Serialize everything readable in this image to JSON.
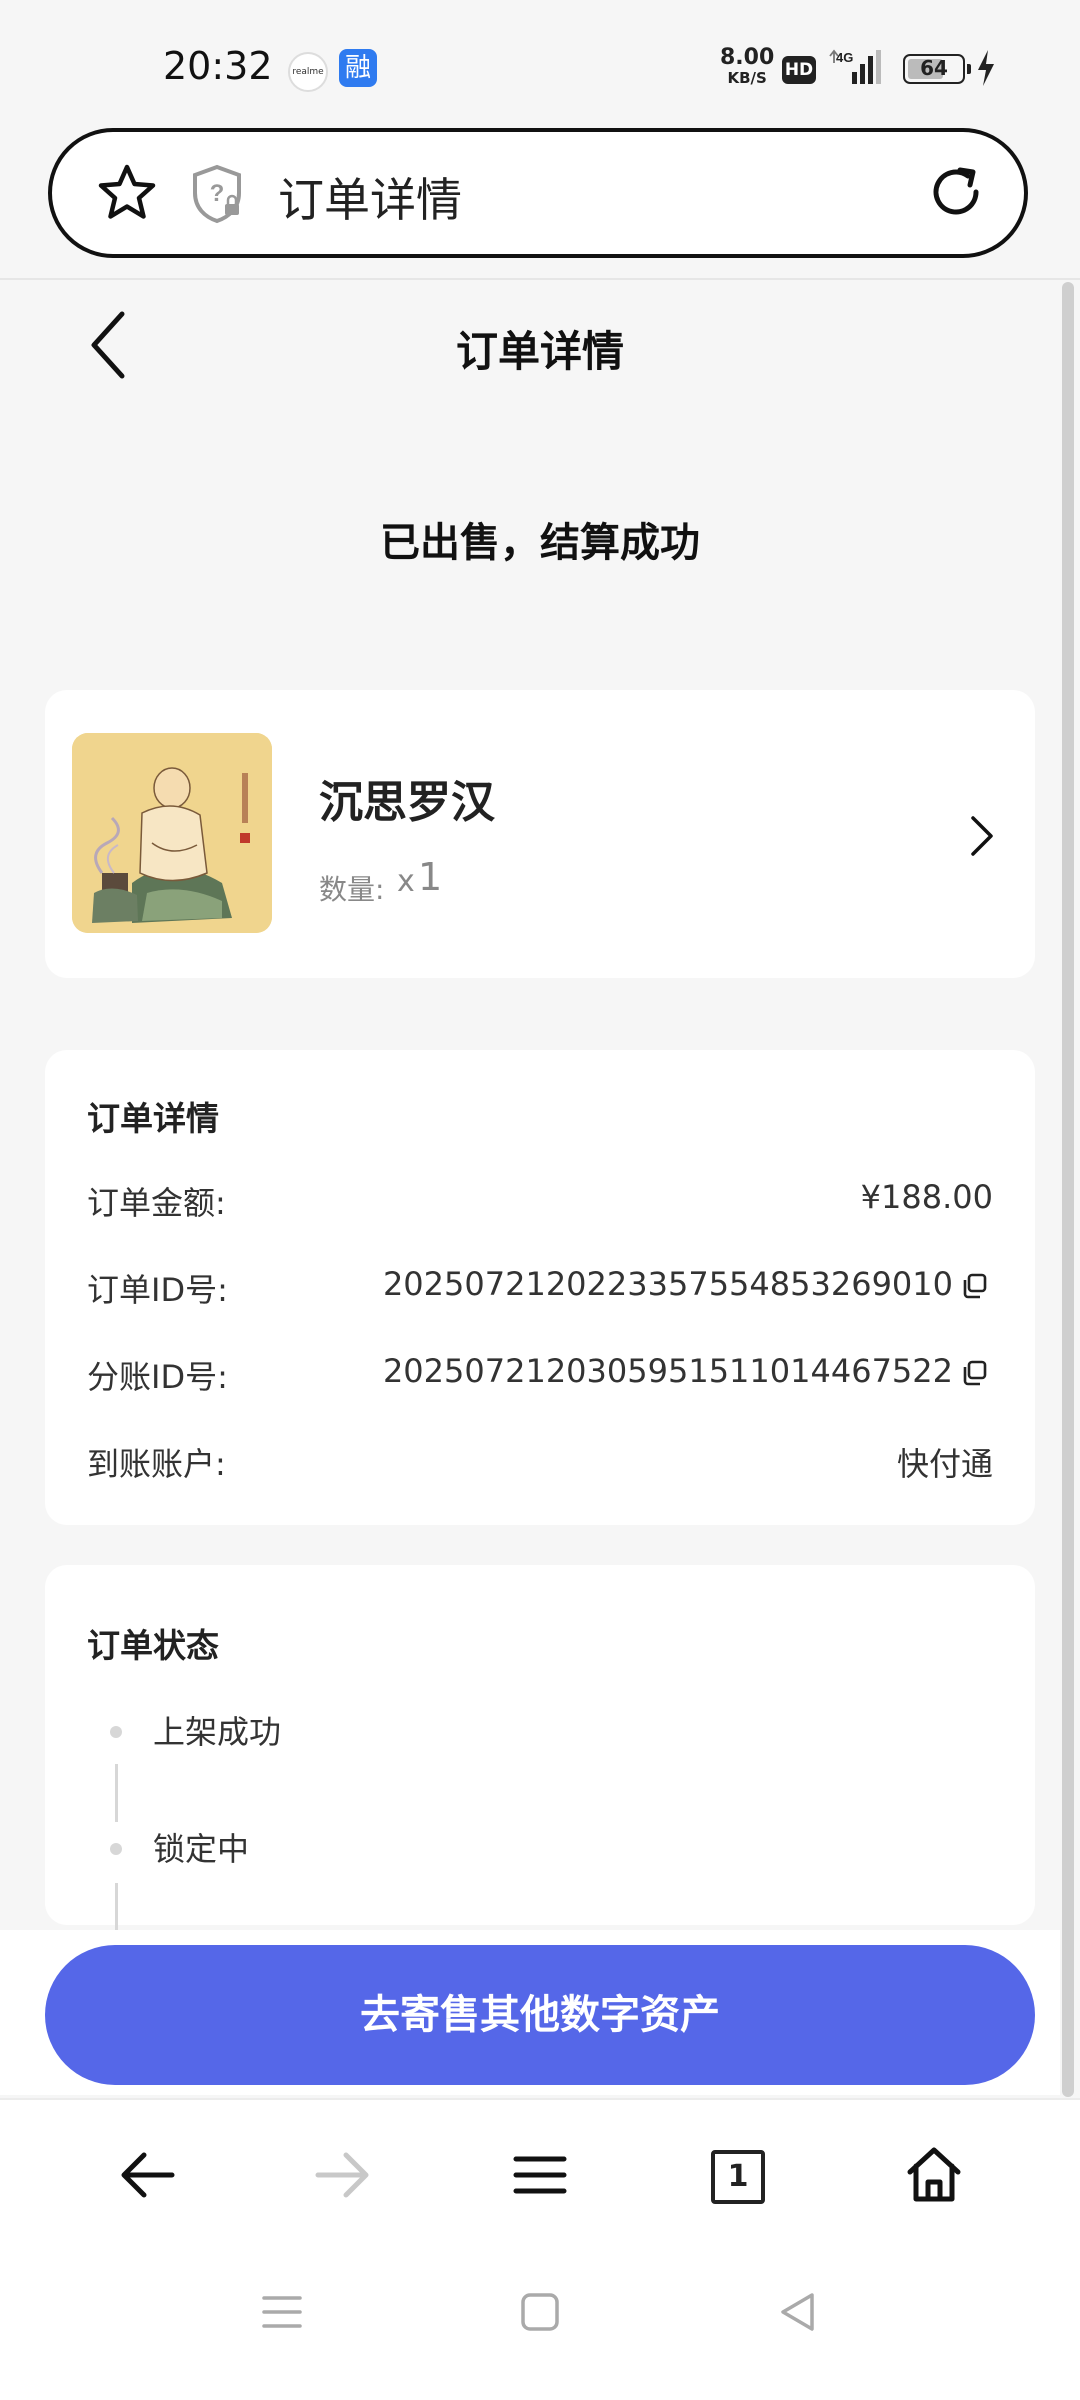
{
  "status_bar": {
    "time": "20:32",
    "realme_icon": "realme",
    "app_icon": "融",
    "net_speed_value": "8.00",
    "net_speed_unit": "KB/S",
    "hd_badge": "HD",
    "network": "4G",
    "battery_level": "64"
  },
  "url_bar": {
    "title": "订单详情"
  },
  "header": {
    "title": "订单详情"
  },
  "order_status_headline": "已出售，结算成功",
  "product": {
    "name": "沉思罗汉",
    "quantity_label": "数量:",
    "quantity_prefix": "x",
    "quantity_value": "1"
  },
  "order_details": {
    "title": "订单详情",
    "rows": [
      {
        "label": "订单金额:",
        "value": "¥188.00"
      },
      {
        "label": "订单ID号:",
        "value": "2025072120223357554853269010"
      },
      {
        "label": "分账ID号:",
        "value": "2025072120305951511014467522"
      },
      {
        "label": "到账账户:",
        "value": "快付通"
      }
    ]
  },
  "order_state": {
    "title": "订单状态",
    "steps": [
      "上架成功",
      "锁定中"
    ]
  },
  "action_button": {
    "label": "去寄售其他数字资产"
  },
  "browser_nav": {
    "tab_count": "1"
  }
}
